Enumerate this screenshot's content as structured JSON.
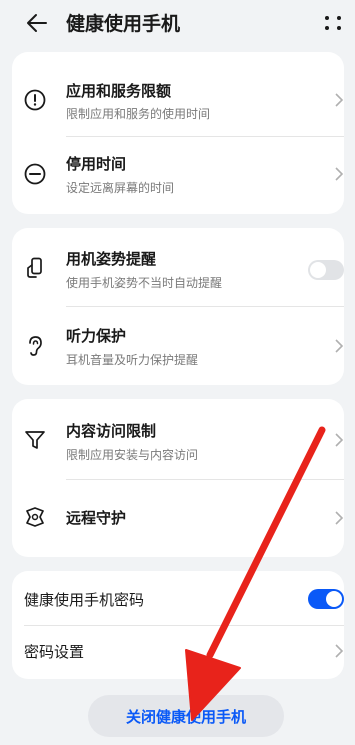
{
  "header": {
    "back_icon": "arrow-left-icon",
    "title": "健康使用手机",
    "more_icon": "four-dots-icon"
  },
  "limits": {
    "app_limit": {
      "title": "应用和服务限额",
      "subtitle": "限制应用和服务的使用时间",
      "icon": "exclamation-circle-icon"
    },
    "downtime": {
      "title": "停用时间",
      "subtitle": "设定远离屏幕的时间",
      "icon": "minus-circle-icon"
    }
  },
  "care": {
    "posture": {
      "title": "用机姿势提醒",
      "subtitle": "使用手机姿势不当时自动提醒",
      "icon": "hand-phone-icon",
      "enabled": false
    },
    "hearing": {
      "title": "听力保护",
      "subtitle": "耳机音量及听力保护提醒",
      "icon": "ear-icon"
    }
  },
  "content": {
    "restrictions": {
      "title": "内容访问限制",
      "subtitle": "限制应用安装与内容访问",
      "icon": "filter-icon"
    },
    "remote": {
      "title": "远程守护",
      "icon": "guard-icon"
    }
  },
  "password": {
    "toggle_label": "健康使用手机密码",
    "enabled": true,
    "settings_label": "密码设置"
  },
  "close_button": "关闭健康使用手机",
  "colors": {
    "accent": "#0a59f7",
    "annotation_arrow": "#e8231b"
  }
}
